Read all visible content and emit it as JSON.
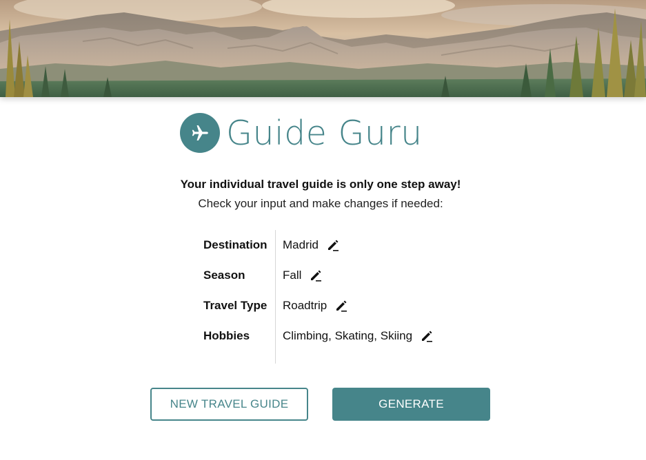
{
  "hero": {
    "icon": "mountain-landscape-image"
  },
  "logo": {
    "icon": "airplane-icon",
    "name": "Guide Guru",
    "color": "#46858a"
  },
  "intro": {
    "title": "Your individual travel guide is only one step away!",
    "subtitle": "Check your input and make changes if needed:"
  },
  "summary": {
    "rows": [
      {
        "label": "Destination",
        "value": "Madrid"
      },
      {
        "label": "Season",
        "value": "Fall"
      },
      {
        "label": "Travel Type",
        "value": "Roadtrip"
      },
      {
        "label": "Hobbies",
        "value": "Climbing, Skating, Skiing"
      }
    ],
    "edit_icon": "pencil-edit-icon"
  },
  "actions": {
    "new_label": "NEW TRAVEL GUIDE",
    "generate_label": "GENERATE"
  },
  "colors": {
    "accent": "#46858a",
    "text": "#111111",
    "background": "#ffffff"
  }
}
